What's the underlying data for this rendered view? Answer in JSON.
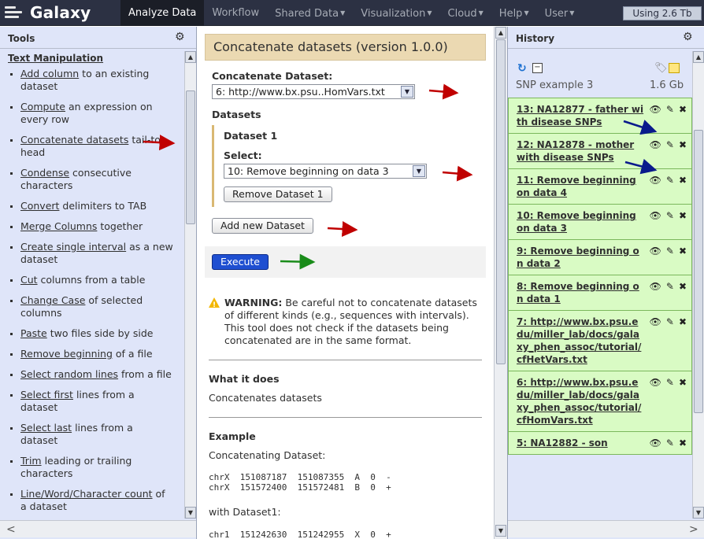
{
  "masthead": {
    "brand": "Galaxy",
    "tabs": [
      {
        "label": "Analyze Data",
        "active": true,
        "caret": false
      },
      {
        "label": "Workflow",
        "active": false,
        "caret": false
      },
      {
        "label": "Shared Data",
        "active": false,
        "caret": true
      },
      {
        "label": "Visualization",
        "active": false,
        "caret": true
      },
      {
        "label": "Cloud",
        "active": false,
        "caret": true
      },
      {
        "label": "Help",
        "active": false,
        "caret": true
      },
      {
        "label": "User",
        "active": false,
        "caret": true
      }
    ],
    "quota": "Using 2.6 Tb"
  },
  "tools": {
    "title": "Tools",
    "section": "Text Manipulation",
    "items": [
      {
        "link": "Add column",
        "rest": " to an existing dataset"
      },
      {
        "link": "Compute",
        "rest": " an expression on every row"
      },
      {
        "link": "Concatenate datasets",
        "rest": " tail-to-head"
      },
      {
        "link": "Condense",
        "rest": " consecutive characters"
      },
      {
        "link": "Convert",
        "rest": " delimiters to TAB"
      },
      {
        "link": "Merge Columns",
        "rest": " together"
      },
      {
        "link": "Create single interval",
        "rest": " as a new dataset"
      },
      {
        "link": "Cut",
        "rest": " columns from a table"
      },
      {
        "link": "Change Case",
        "rest": " of selected columns"
      },
      {
        "link": "Paste",
        "rest": " two files side by side"
      },
      {
        "link": "Remove beginning",
        "rest": " of a file"
      },
      {
        "link": "Select random lines",
        "rest": " from a file"
      },
      {
        "link": "Select first",
        "rest": " lines from a dataset"
      },
      {
        "link": "Select last",
        "rest": " lines from a dataset"
      },
      {
        "link": "Trim",
        "rest": " leading or trailing characters"
      },
      {
        "link": "Line/Word/Character count",
        "rest": " of a dataset"
      }
    ]
  },
  "form": {
    "title": "Concatenate datasets (version 1.0.0)",
    "concat_label": "Concatenate Dataset:",
    "concat_value": "6: http://www.bx.psu..HomVars.txt",
    "datasets_label": "Datasets",
    "dataset1_label": "Dataset 1",
    "select_label": "Select:",
    "select_value": "10: Remove beginning on data 3",
    "remove_btn": "Remove Dataset 1",
    "add_btn": "Add new Dataset",
    "execute_btn": "Execute"
  },
  "help": {
    "warning_bold": "WARNING:",
    "warning_text": " Be careful not to concatenate datasets of different kinds (e.g., sequences with intervals). This tool does not check if the datasets being concatenated are in the same format.",
    "what_heading": "What it does",
    "what_text": "Concatenates datasets",
    "example_heading": "Example",
    "concat_ds_label": "Concatenating Dataset:",
    "concat_rows": "chrX  151087187  151087355  A  0  -\nchrX  151572400  151572481  B  0  +",
    "with_label": "with Dataset1:",
    "ds1_rows": "chr1  151242630  151242955  X  0  +"
  },
  "history": {
    "title": "History",
    "name": "SNP example 3",
    "size": "1.6 Gb",
    "datasets": [
      {
        "name": "13: NA12877 - father with disease SNPs"
      },
      {
        "name": "12: NA12878 - mother with disease SNPs"
      },
      {
        "name": "11: Remove beginning on data 4"
      },
      {
        "name": "10: Remove beginning on data 3"
      },
      {
        "name": "9: Remove beginning on data 2"
      },
      {
        "name": "8: Remove beginning on data 1"
      },
      {
        "name": "7: http://www.bx.psu.edu/miller_lab/docs/galaxy_phen_assoc/tutorial/cfHetVars.txt"
      },
      {
        "name": "6: http://www.bx.psu.edu/miller_lab/docs/galaxy_phen_assoc/tutorial/cfHomVars.txt"
      },
      {
        "name": "5: NA12882 - son"
      }
    ]
  },
  "colors": {
    "red_arrow": "#c00000",
    "blue_arrow": "#0a1a8c",
    "green_arrow": "#1a8c1a"
  }
}
